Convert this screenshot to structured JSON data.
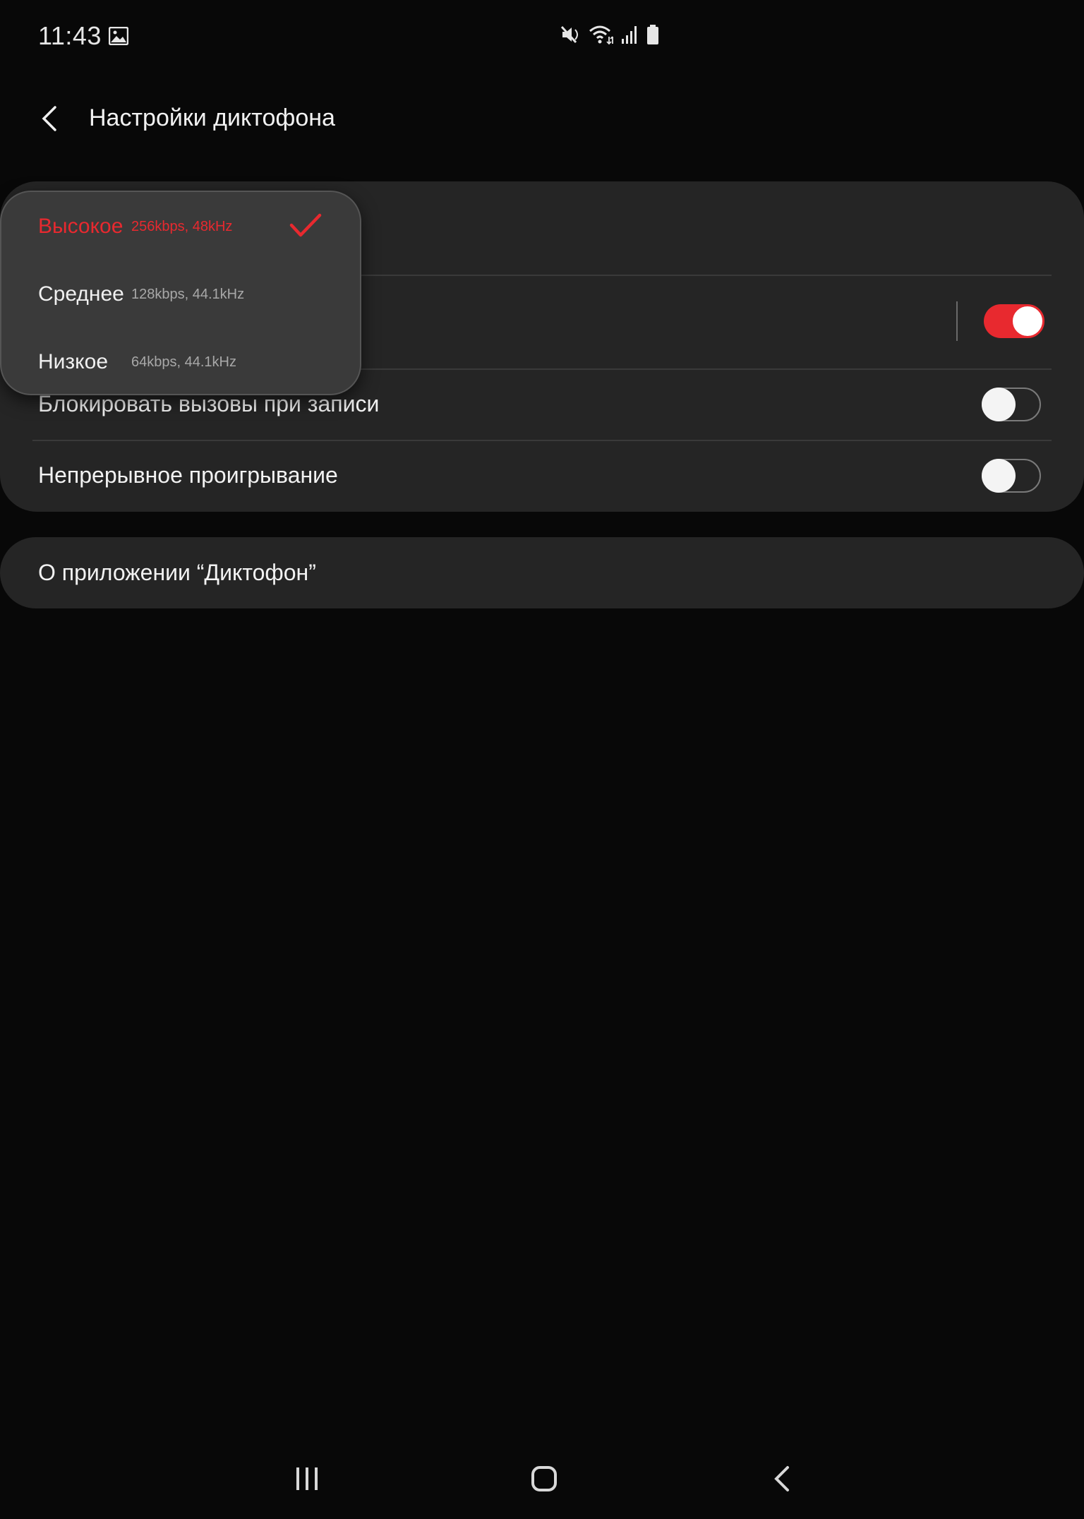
{
  "status_bar": {
    "time": "11:43",
    "icons": [
      "gallery-icon",
      "mute-icon",
      "wifi-icon",
      "signal-icon",
      "battery-icon"
    ]
  },
  "header": {
    "title": "Настройки диктофона",
    "back_icon": "back-arrow-icon"
  },
  "quality_popup": {
    "options": [
      {
        "name": "Высокое",
        "detail": "256kbps, 48kHz",
        "selected": true
      },
      {
        "name": "Среднее",
        "detail": "128kbps, 44.1kHz",
        "selected": false
      },
      {
        "name": "Низкое",
        "detail": "64kbps, 44.1kHz",
        "selected": false
      }
    ]
  },
  "settings": {
    "rows": [
      {
        "label": "",
        "toggle": true
      },
      {
        "label": "Блокировать вызовы при записи",
        "toggle": false
      },
      {
        "label": "Непрерывное проигрывание",
        "toggle": false
      }
    ]
  },
  "about": {
    "label": "О приложении “Диктофон”"
  },
  "nav_bar": {
    "icons": [
      "recents-icon",
      "home-icon",
      "back-icon"
    ]
  },
  "colors": {
    "accent": "#e8292f",
    "background": "#080808",
    "card": "#252525",
    "popup": "#3a3a3a"
  }
}
